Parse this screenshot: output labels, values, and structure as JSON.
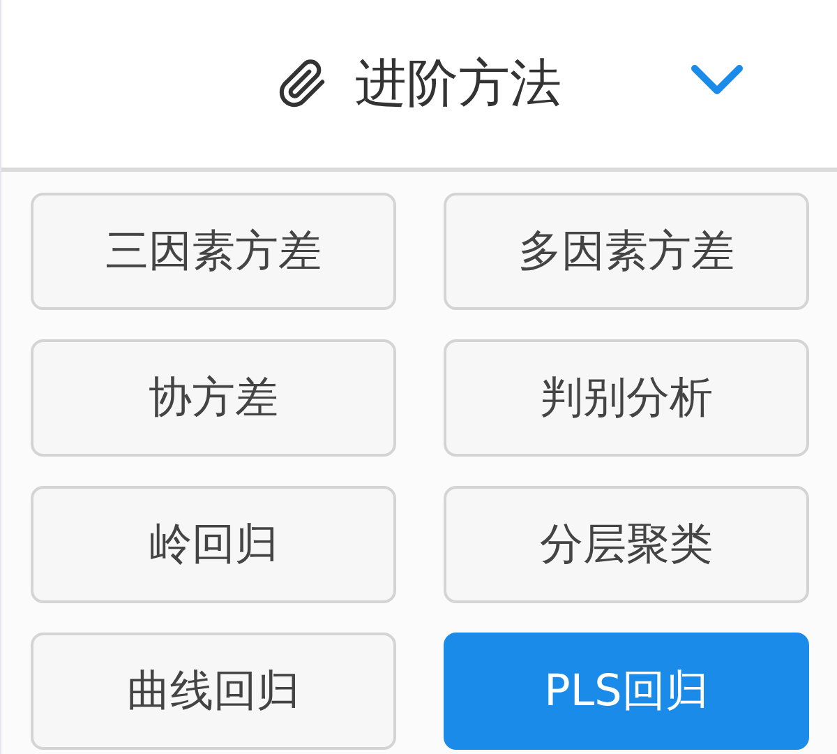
{
  "header": {
    "title": "进阶方法",
    "expanded": true
  },
  "methods": [
    {
      "label": "三因素方差",
      "selected": false
    },
    {
      "label": "多因素方差",
      "selected": false
    },
    {
      "label": "协方差",
      "selected": false
    },
    {
      "label": "判别分析",
      "selected": false
    },
    {
      "label": "岭回归",
      "selected": false
    },
    {
      "label": "分层聚类",
      "selected": false
    },
    {
      "label": "曲线回归",
      "selected": false
    },
    {
      "label": "PLS回归",
      "selected": true
    }
  ]
}
